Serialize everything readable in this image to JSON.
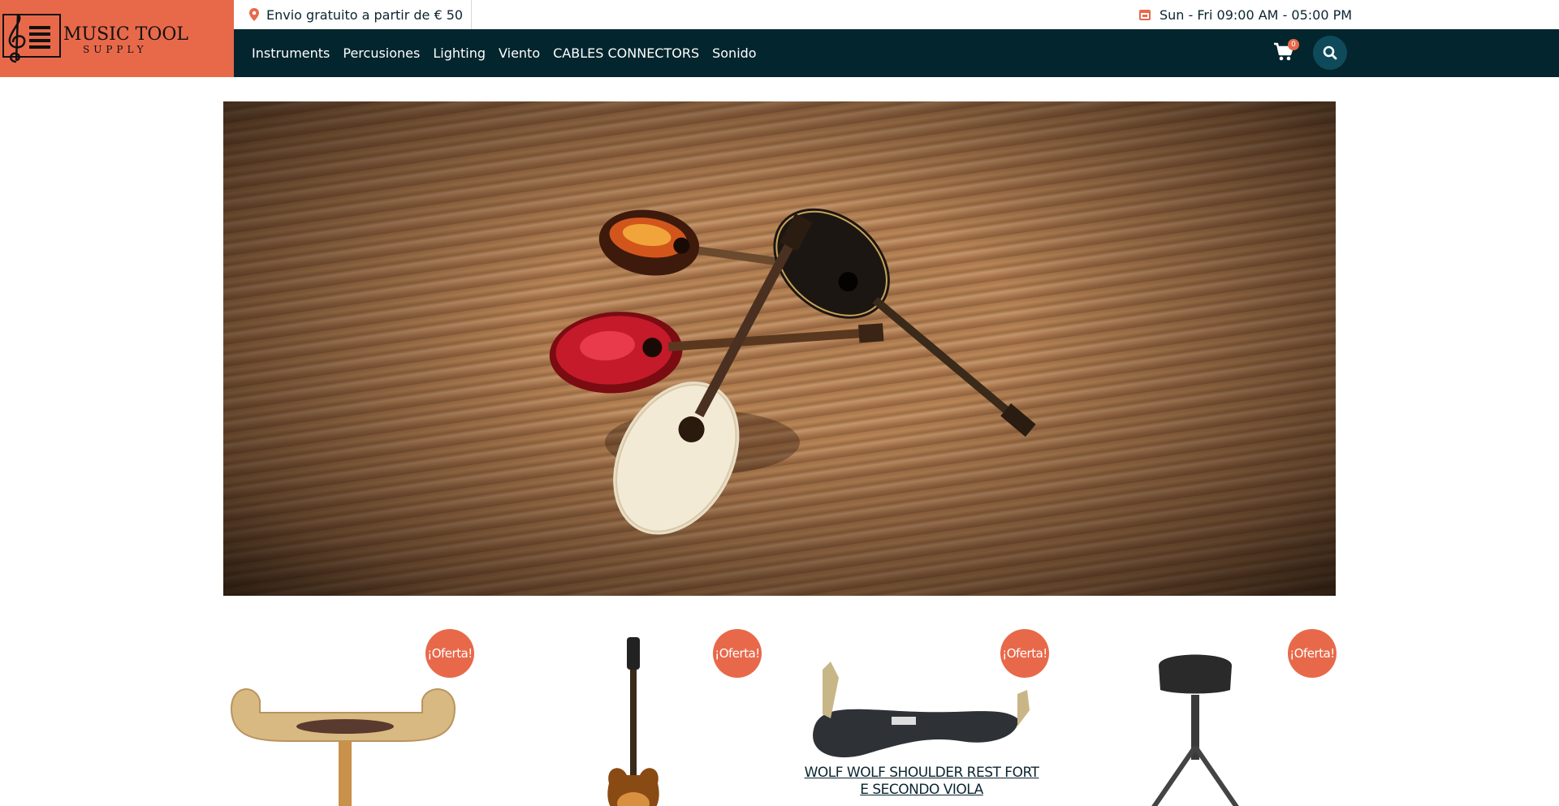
{
  "brand": {
    "logo_name": "MUSIC TOOL",
    "logo_sub": "SUPPLY",
    "accent_color": "#e8694a",
    "nav_bg": "#03252d"
  },
  "topbar": {
    "shipping_icon": "map-pin-icon",
    "shipping_text": "Envio gratuito a partir de € 50",
    "hours_icon": "calendar-icon",
    "hours_text": "Sun - Fri 09:00 AM - 05:00 PM"
  },
  "nav": {
    "items": [
      "Instruments",
      "Percusiones",
      "Lighting",
      "Viento",
      "CABLES CONNECTORS",
      "Sonido"
    ],
    "cart_count": "0"
  },
  "products": [
    {
      "badge": "¡Oferta!",
      "image": "violin-shoulder-rest"
    },
    {
      "badge": "¡Oferta!",
      "image": "electric-guitar"
    },
    {
      "badge": "¡Oferta!",
      "image": "wolf-shoulder-rest",
      "title": "WOLF WOLF SHOULDER REST FORT E SECONDO VIOLA"
    },
    {
      "badge": "¡Oferta!",
      "image": "keyboard-stool"
    }
  ]
}
